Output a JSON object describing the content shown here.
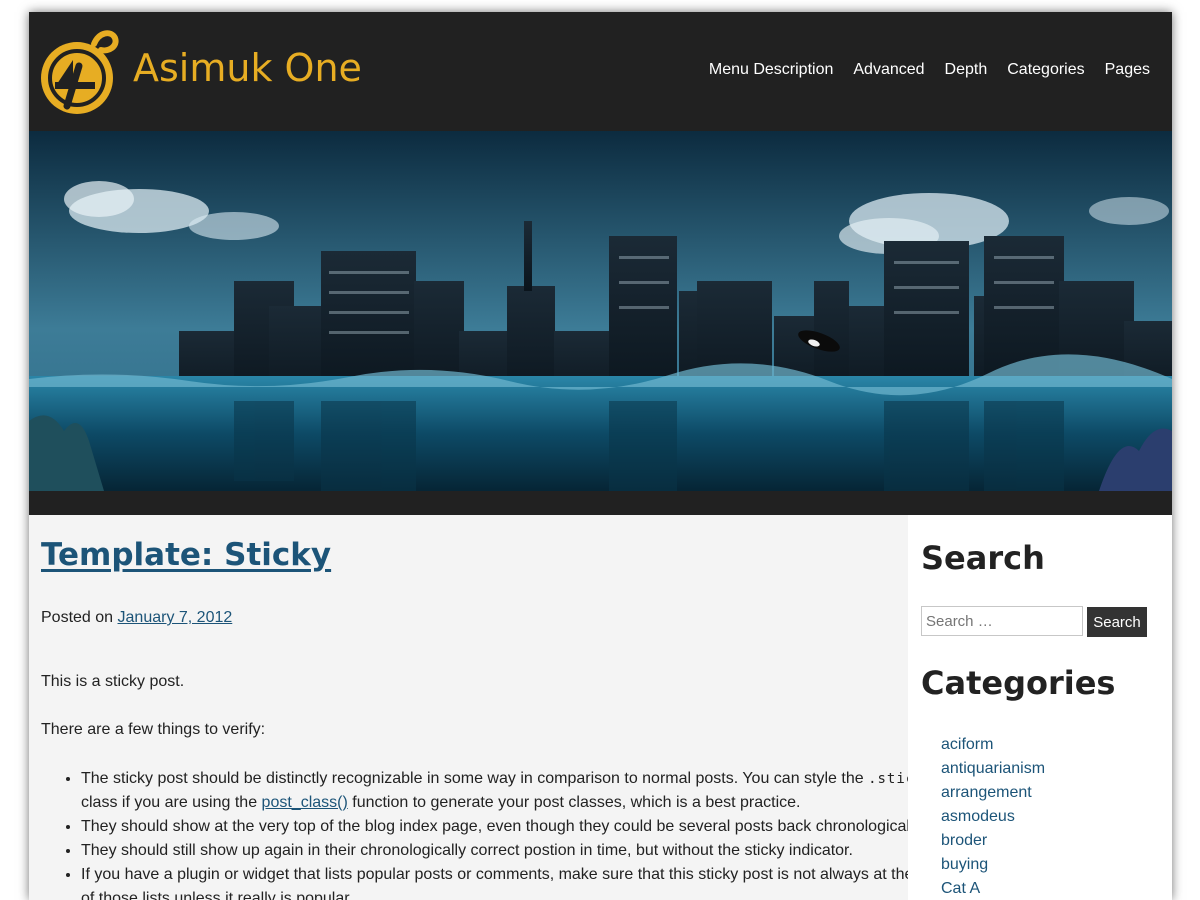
{
  "site": {
    "title": "Asimuk One"
  },
  "nav": {
    "items": [
      "Menu Description",
      "Advanced",
      "Depth",
      "Categories",
      "Pages"
    ]
  },
  "post": {
    "title": "Template: Sticky",
    "posted_prefix": "Posted on",
    "date": "January 7, 2012",
    "p1": "This is a sticky post.",
    "p2": "There are a few things to verify:",
    "bullets": [
      {
        "pre": "The sticky post should be distinctly recognizable in some way in comparison to normal posts. You can style the ",
        "code": ".sticky",
        "mid": " class if you are using the ",
        "link": "post_class()",
        "post": " function to generate your post classes, which is a best practice."
      },
      {
        "text": "They should show at the very top of the blog index page, even though they could be several posts back chronologically."
      },
      {
        "text": "They should still show up again in their chronologically correct postion in time, but without the sticky indicator."
      },
      {
        "text": "If you have a plugin or widget that lists popular posts or comments, make sure that this sticky post is not always at the top of those lists unless it really is popular."
      }
    ]
  },
  "sidebar": {
    "search_title": "Search",
    "search_placeholder": "Search …",
    "search_button": "Search",
    "categories_title": "Categories",
    "categories": [
      "aciform",
      "antiquarianism",
      "arrangement",
      "asmodeus",
      "broder",
      "buying",
      "Cat A"
    ]
  },
  "colors": {
    "header_bg": "#212121",
    "title_gold": "#e7ad23",
    "link_blue": "#1c5478",
    "content_bg": "#f4f4f4"
  }
}
